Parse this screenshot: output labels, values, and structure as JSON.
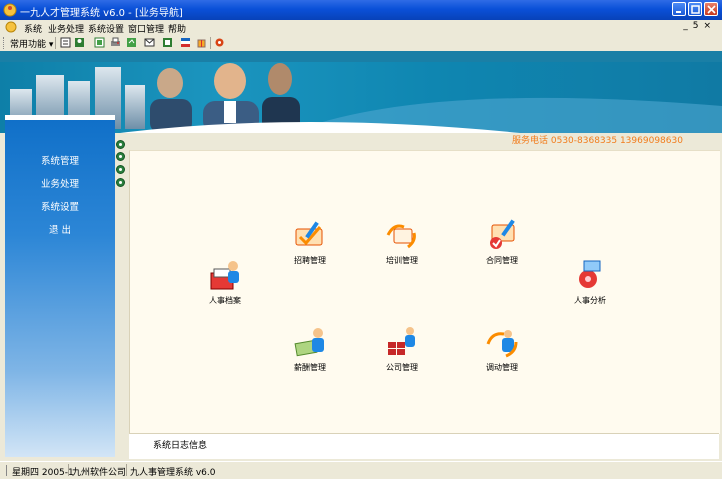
{
  "window": {
    "title": "一九人才管理系统 v6.0 - [业务导航]",
    "app_icon": "app-icon"
  },
  "menu": {
    "items": [
      "系统",
      "业务处理",
      "系统设置",
      "窗口管理",
      "帮助"
    ],
    "mdi_controls": [
      "_",
      "5",
      "×"
    ]
  },
  "toolbar": {
    "function_label": "常用功能 ▾",
    "icons": [
      "report-icon",
      "users-icon",
      "notepad-icon",
      "printer-icon",
      "export-icon",
      "mail-icon",
      "sheet-icon",
      "flag-icon",
      "gift-icon",
      "tools-icon"
    ]
  },
  "service_phone": "服务电话 0530-8368335 13969098630",
  "nav": {
    "items": [
      "系统管理",
      "业务处理",
      "系统设置",
      "退  出"
    ]
  },
  "modules": {
    "resume": {
      "label": "人事档案"
    },
    "recruit": {
      "label": "招聘管理"
    },
    "training": {
      "label": "培训管理"
    },
    "contract": {
      "label": "合同管理"
    },
    "personnel": {
      "label": "人事分析"
    },
    "salary": {
      "label": "薪酬管理"
    },
    "company": {
      "label": "公司管理"
    },
    "transfer": {
      "label": "调动管理"
    }
  },
  "log_info": "系统日志信息",
  "status": {
    "date": "星期四 2005-1",
    "company": "九州软件公司",
    "product": "九人事管理系统 v6.0"
  },
  "colors": {
    "titlebar": "#0A50D8",
    "nav_top": "#0F6FC8",
    "phone_text": "#F27C1C",
    "panel_bg": "#FFFBEF"
  }
}
